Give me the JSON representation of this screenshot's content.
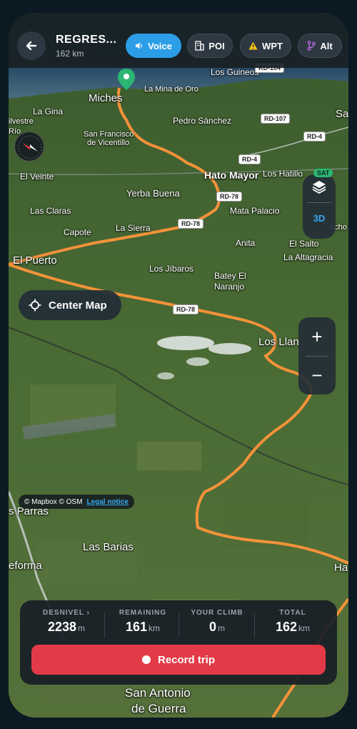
{
  "header": {
    "title": "REGRES...",
    "distance": "162 km",
    "chips": {
      "voice": "Voice",
      "poi": "POI",
      "wpt": "WPT",
      "alt": "Alt"
    }
  },
  "map_controls": {
    "layers_badge": "SAT",
    "mode_3d": "3D",
    "center_map": "Center Map",
    "zoom_in": "+",
    "zoom_out": "−"
  },
  "attribution": {
    "text": "© Mapbox © OSM",
    "legal": "Legal notice"
  },
  "map_labels": {
    "los_guineos": "Los Guineos",
    "rd104": "RD-104",
    "la_mina": "La Mina de Oro",
    "miches": "Miches",
    "la_gina": "La Gina",
    "silvestre": "ilvestre",
    "rio": "Río",
    "pedro": "Pedro Sánchez",
    "rd107": "RD-107",
    "sa": "Sa",
    "sanfran": "San Francisco",
    "vicentillo": "de Vicentillo",
    "rd4a": "RD-4",
    "rd4b": "RD-4",
    "el_veinte": "El Veinte",
    "hato_mayor": "Hato Mayor",
    "los_hatillo": "Los Hatillo",
    "yerba": "Yerba Buena",
    "rd78a": "RD-78",
    "las_claras": "Las Claras",
    "mata": "Mata Palacio",
    "capote": "Capote",
    "la_sierra": "La Sierra",
    "rd78b": "RD-78",
    "echo": "echo",
    "anita": "Anita",
    "el_salto": "El Salto",
    "el_puerto": "El Puerto",
    "la_altagracia": "La Altagracia",
    "los_jibaros": "Los Jíbaros",
    "batey": "Batey El",
    "naranjo": "Naranjo",
    "rd78c": "RD-78",
    "los_llan": "Los Llan",
    "parras": "s Parras",
    "las_barias": "Las Barias",
    "reforma": "eforma",
    "ha": "Ha",
    "san_antonio": "San Antonio",
    "de_guerra": "de Guerra"
  },
  "stats": {
    "desnivel": {
      "label": "DESNIVEL ›",
      "value": "2238",
      "unit": "m"
    },
    "remaining": {
      "label": "REMAINING",
      "value": "161",
      "unit": "km"
    },
    "your_climb": {
      "label": "YOUR CLIMB",
      "value": "0",
      "unit": "m"
    },
    "total": {
      "label": "TOTAL",
      "value": "162",
      "unit": "km"
    }
  },
  "record_button": "Record trip",
  "colors": {
    "route": "#f5923a",
    "accent_blue": "#2c9ee8",
    "record_red": "#e23a47",
    "marker_green": "#2bb673"
  }
}
